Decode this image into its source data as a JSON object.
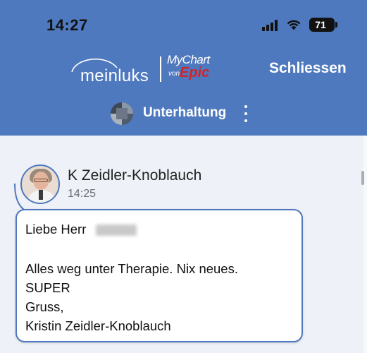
{
  "status_bar": {
    "time": "14:27",
    "battery": "71",
    "signal_icon": "cellular-signal-icon",
    "wifi_icon": "wifi-icon"
  },
  "header": {
    "logo_left": "meinluks",
    "logo_right_line1": "MyChart",
    "logo_right_von": "von",
    "logo_right_epic": "Epic",
    "close_label": "Schliessen",
    "title": "Unterhaltung",
    "menu_icon": "more-vertical-icon"
  },
  "message": {
    "sender": "K Zeidler-Knoblauch",
    "time": "14:25",
    "greeting": "Liebe Herr",
    "body_line1": "Alles weg unter Therapie. Nix neues.",
    "body_line2": "SUPER",
    "body_line3": "Gruss,",
    "body_line4": "Kristin Zeidler-Knoblauch"
  },
  "colors": {
    "header_bg": "#4f79be",
    "content_bg": "#eef1f7",
    "epic_red": "#d2232a",
    "bubble_border": "#4f79be"
  }
}
